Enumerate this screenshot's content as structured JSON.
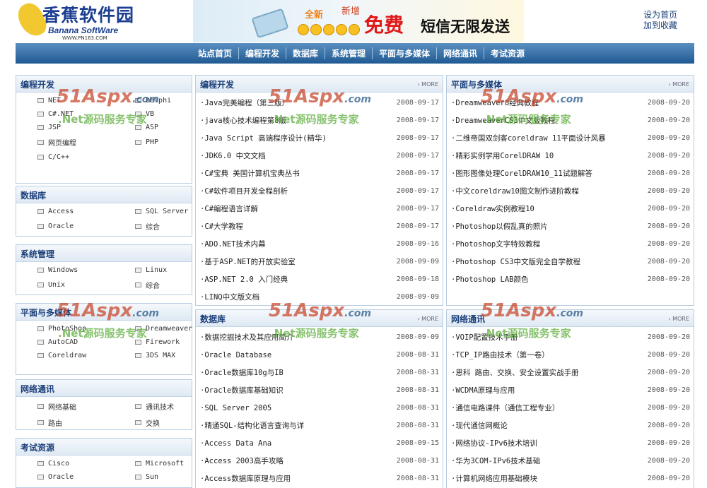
{
  "header": {
    "logo_text": "香蕉软件园",
    "logo_sub": "Banana SoftWare",
    "logo_url": "WWW.PN163.COM",
    "banner_new": "全新",
    "banner_mark": "新增",
    "banner_free": "免费",
    "banner_sms": "短信无限发送",
    "set_home": "设为首页",
    "add_fav": "加到收藏"
  },
  "nav": [
    "站点首页",
    "编程开发",
    "数据库",
    "系统管理",
    "平面与多媒体",
    "网络通讯",
    "考试资源"
  ],
  "more_label": "MORE",
  "watermark": {
    "brand": "51Aspx",
    "domain": ".com",
    "slogan": ".Net源码服务专家"
  },
  "sidebar": [
    {
      "title": "编程开发",
      "items": [
        "NET",
        "Delphi",
        "C#.NET",
        "VB",
        "JSP",
        "ASP",
        "网页编程",
        "PHP",
        "C/C++"
      ]
    },
    {
      "title": "数据库",
      "items": [
        "Access",
        "SQL Server",
        "Oracle",
        "综合"
      ]
    },
    {
      "title": "系统管理",
      "items": [
        "Windows",
        "Linux",
        "Unix",
        "综合"
      ]
    },
    {
      "title": "平面与多媒体",
      "items": [
        "PhotoShop",
        "Dreamweaver",
        "AutoCAD",
        "Firework",
        "Coreldraw",
        "3DS MAX"
      ]
    },
    {
      "title": "网络通讯",
      "items": [
        "网络基础",
        "通讯技术",
        "路由",
        "交换"
      ]
    },
    {
      "title": "考试资源",
      "items": [
        "Cisco",
        "Microsoft",
        "Oracle",
        "Sun"
      ]
    }
  ],
  "panels": [
    {
      "title": "编程开发",
      "items": [
        {
          "t": "·Java完美编程（第三版）",
          "d": "2008-09-17"
        },
        {
          "t": "·java核心技术编程第8版",
          "d": "2008-09-17"
        },
        {
          "t": "·Java Script 高端程序设计(精华)",
          "d": "2008-09-17"
        },
        {
          "t": "·JDK6.0 中文文档",
          "d": "2008-09-17"
        },
        {
          "t": "·C#宝典 美国计算机宝典丛书",
          "d": "2008-09-17"
        },
        {
          "t": "·C#软件项目开发全程剖析",
          "d": "2008-09-17"
        },
        {
          "t": "·C#编程语言详解",
          "d": "2008-09-17"
        },
        {
          "t": "·C#大学教程",
          "d": "2008-09-17"
        },
        {
          "t": "·ADO.NET技术内幕",
          "d": "2008-09-16"
        },
        {
          "t": "·基于ASP.NET的开放实验室",
          "d": "2008-09-09"
        },
        {
          "t": "·ASP.NET 2.0 入门经典",
          "d": "2008-09-18"
        },
        {
          "t": "·LINQ中文版文档",
          "d": "2008-09-09"
        }
      ]
    },
    {
      "title": "平面与多媒体",
      "items": [
        {
          "t": "·Dreamweaver8经典教程",
          "d": "2008-09-20"
        },
        {
          "t": "·DreamweaverCS3中文版教程",
          "d": "2008-09-20"
        },
        {
          "t": "·二维帝国双剑客coreldraw 11平面设计风暴",
          "d": "2008-09-20"
        },
        {
          "t": "·精彩实例学用CorelDRAW 10",
          "d": "2008-09-20"
        },
        {
          "t": "·图形图像处理CorelDRAW10_11试题解答",
          "d": "2008-09-20"
        },
        {
          "t": "·中文coreldraw10图文制作进阶教程",
          "d": "2008-09-20"
        },
        {
          "t": "·Coreldraw实例教程10",
          "d": "2008-09-20"
        },
        {
          "t": "·Photoshop以假乱真的照片",
          "d": "2008-09-20"
        },
        {
          "t": "·Photoshop文字特效教程",
          "d": "2008-09-20"
        },
        {
          "t": "·Photoshop CS3中文版完全自学教程",
          "d": "2008-09-20"
        },
        {
          "t": "·Photoshop LAB颜色",
          "d": "2008-09-20"
        }
      ]
    },
    {
      "title": "数据库",
      "items": [
        {
          "t": "·数据挖掘技术及其应用简介",
          "d": "2008-09-09"
        },
        {
          "t": "·Oracle Database",
          "d": "2008-08-31"
        },
        {
          "t": "·Oracle数据库10g与IB",
          "d": "2008-08-31"
        },
        {
          "t": "·Oracle数据库基础知识",
          "d": "2008-08-31"
        },
        {
          "t": "·SQL Server 2005",
          "d": "2008-08-31"
        },
        {
          "t": "·精通SQL-结构化语言查询与详",
          "d": "2008-08-31"
        },
        {
          "t": "·Access Data Ana",
          "d": "2008-09-15"
        },
        {
          "t": "·Access 2003高手攻略",
          "d": "2008-08-31"
        },
        {
          "t": "·Access数据库原理与应用",
          "d": "2008-08-31"
        }
      ]
    },
    {
      "title": "网络通讯",
      "items": [
        {
          "t": "·VOIP配置技术手册",
          "d": "2008-09-20"
        },
        {
          "t": "·TCP_IP路由技术（第一卷）",
          "d": "2008-09-20"
        },
        {
          "t": "·思科 路由、交换、安全设置实战手册",
          "d": "2008-09-20"
        },
        {
          "t": "·WCDMA原理与应用",
          "d": "2008-09-20"
        },
        {
          "t": "·通信电路课件（通信工程专业）",
          "d": "2008-09-20"
        },
        {
          "t": "·现代通信网概论",
          "d": "2008-09-20"
        },
        {
          "t": "·网络协议-IPv6技术培训",
          "d": "2008-09-20"
        },
        {
          "t": "·华为3COM-IPv6技术基础",
          "d": "2008-09-20"
        },
        {
          "t": "·计算机网络应用基础模块",
          "d": "2008-09-20"
        }
      ]
    }
  ]
}
